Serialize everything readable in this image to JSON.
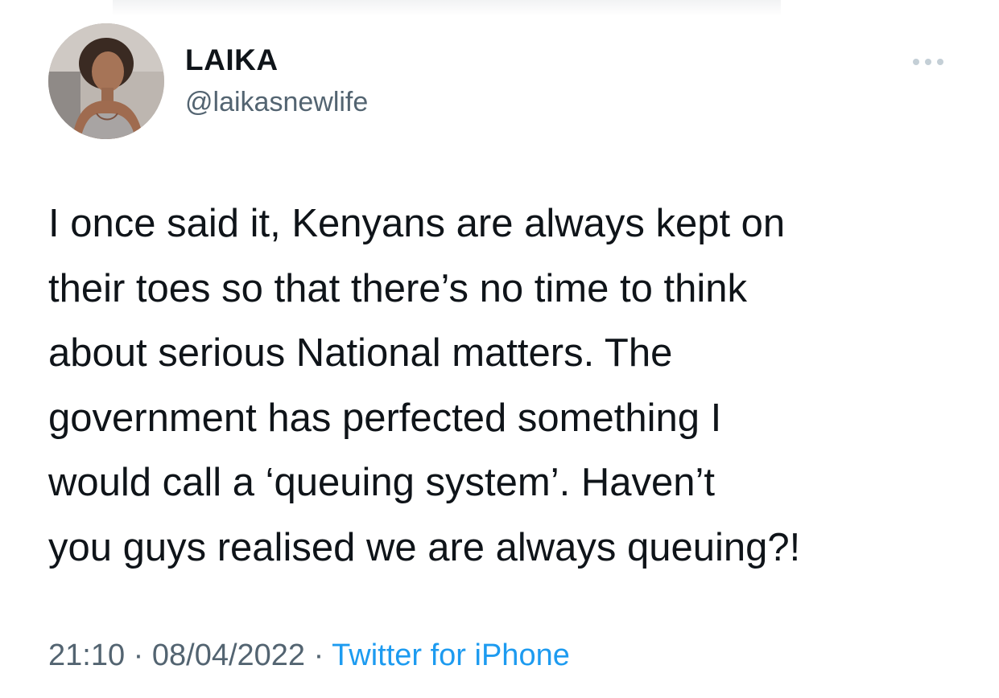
{
  "tweet": {
    "author": {
      "display_name": "LAIKA",
      "handle": "@laikasnewlife",
      "avatar_icon": "profile-photo"
    },
    "more_icon": "more-horizontal-icon",
    "text_lines": [
      "I once said it, Kenyans are always kept on",
      "their toes so that there’s no time to think",
      "about serious National matters. The",
      "government has perfected something I",
      "would call a ‘queuing system’. Haven’t",
      "you guys realised we are always queuing?!"
    ],
    "time": "21:10",
    "separator": "·",
    "date": "08/04/2022",
    "source": "Twitter for iPhone"
  },
  "colors": {
    "text_primary": "#0f1419",
    "text_secondary": "#536471",
    "link": "#1d9bf0",
    "background": "#ffffff"
  }
}
